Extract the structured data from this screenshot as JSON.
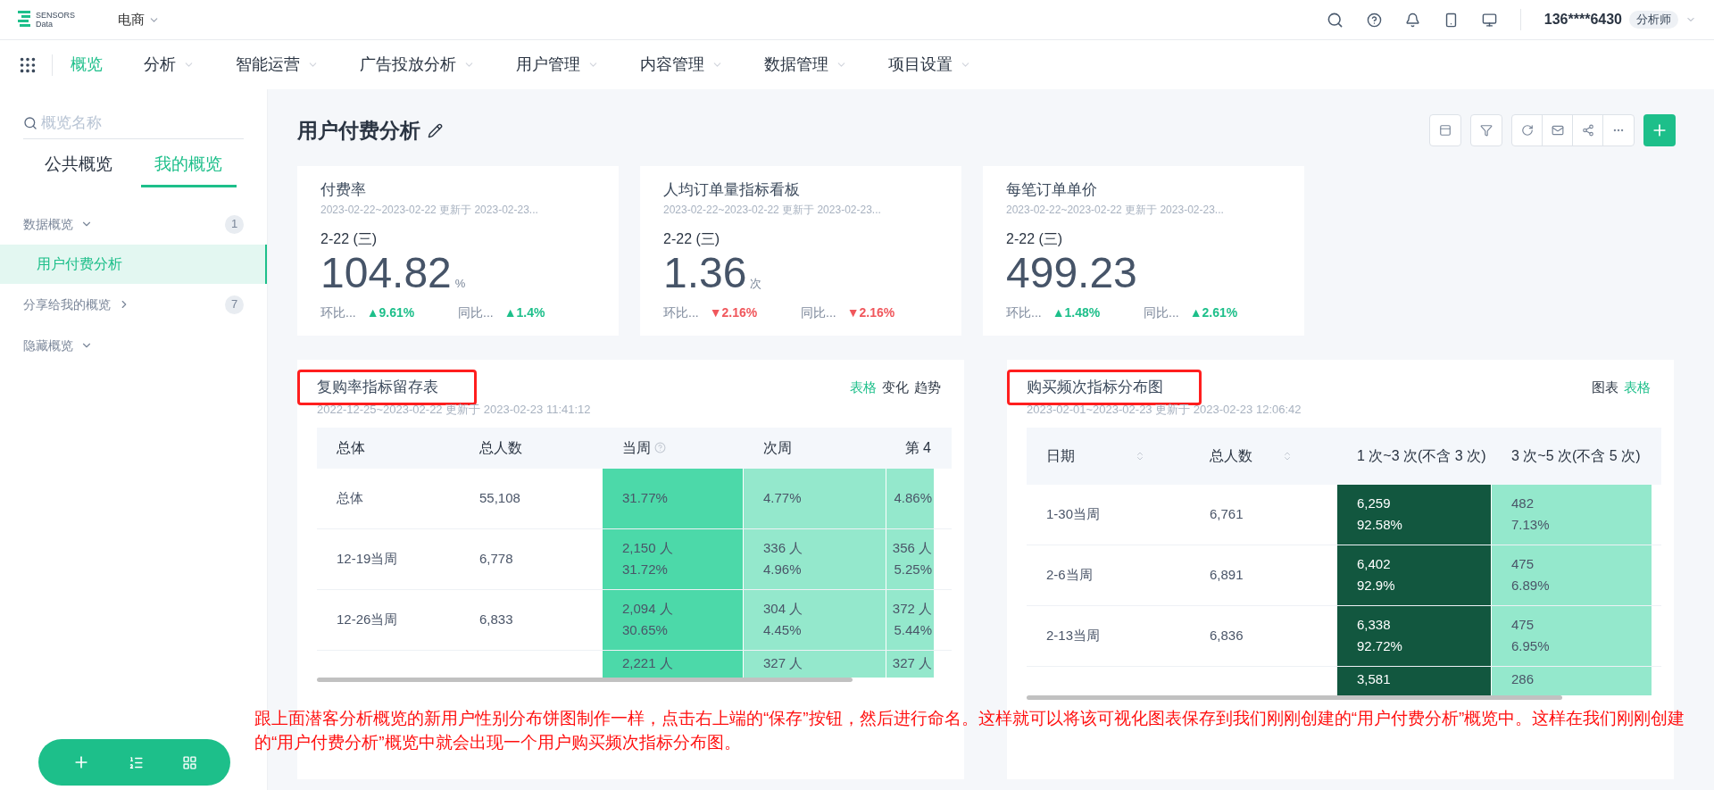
{
  "top_bar": {
    "logo_lines": [
      "SENSORS",
      "Data"
    ],
    "project": "电商",
    "user": "136****6430",
    "role": "分析师"
  },
  "nav": [
    {
      "label": "概览",
      "selected": true,
      "has_menu": false
    },
    {
      "label": "分析",
      "selected": false,
      "has_menu": true
    },
    {
      "label": "智能运营",
      "selected": false,
      "has_menu": true
    },
    {
      "label": "广告投放分析",
      "selected": false,
      "has_menu": true
    },
    {
      "label": "用户管理",
      "selected": false,
      "has_menu": true
    },
    {
      "label": "内容管理",
      "selected": false,
      "has_menu": true
    },
    {
      "label": "数据管理",
      "selected": false,
      "has_menu": true
    },
    {
      "label": "项目设置",
      "selected": false,
      "has_menu": true
    }
  ],
  "sidebar": {
    "search_placeholder": "概览名称",
    "tabs": [
      {
        "label": "公共概览",
        "selected": false
      },
      {
        "label": "我的概览",
        "selected": true
      }
    ],
    "groups": [
      {
        "label": "数据概览",
        "expanded": true,
        "count": "1",
        "children": [
          {
            "label": "用户付费分析",
            "selected": true
          }
        ]
      },
      {
        "label": "分享给我的概览",
        "expanded": false,
        "count": "7"
      },
      {
        "label": "隐藏概览",
        "expanded": true
      }
    ]
  },
  "page": {
    "title": "用户付费分析"
  },
  "cards": [
    {
      "title": "付费率",
      "subtitle": "2023-02-22~2023-02-22 更新于 2023-02-23...",
      "date": "2-22 (三)",
      "value": "104.82",
      "unit": "%",
      "comparisons": [
        {
          "label": "环比...",
          "value": "▲9.61%",
          "negative": false
        },
        {
          "label": "同比...",
          "value": "▲1.4%",
          "negative": false
        }
      ]
    },
    {
      "title": "人均订单量指标看板",
      "subtitle": "2023-02-22~2023-02-22 更新于 2023-02-23...",
      "date": "2-22 (三)",
      "value": "1.36",
      "unit": "次",
      "comparisons": [
        {
          "label": "环比...",
          "value": "▼2.16%",
          "negative": true
        },
        {
          "label": "同比...",
          "value": "▼2.16%",
          "negative": true
        }
      ]
    },
    {
      "title": "每笔订单单价",
      "subtitle": "2023-02-22~2023-02-22 更新于 2023-02-23...",
      "date": "2-22 (三)",
      "value": "499.23",
      "comparisons": [
        {
          "label": "环比...",
          "value": "▲1.48%",
          "negative": false
        },
        {
          "label": "同比...",
          "value": "▲2.61%",
          "negative": false
        }
      ]
    }
  ],
  "panels": [
    {
      "title": "复购率指标留存表",
      "highlighted": true,
      "subtitle": "2022-12-25~2023-02-22 更新于 2023-02-23 11:41:12",
      "view_tabs": [
        {
          "label": "表格",
          "selected": true
        },
        {
          "label": "变化",
          "selected": false
        },
        {
          "label": "趋势",
          "selected": false
        }
      ],
      "columns": [
        {
          "label": "总体"
        },
        {
          "label": "总人数"
        },
        {
          "label": "当周",
          "help": true
        },
        {
          "label": "次周"
        },
        {
          "label": "第 4",
          "right_aligned": true
        }
      ],
      "rows": [
        {
          "cells": [
            {
              "lines": [
                "总体"
              ]
            },
            {
              "lines": [
                "55,108"
              ]
            },
            {
              "lines": [
                "31.77%"
              ],
              "color": "#4cd9a9"
            },
            {
              "lines": [
                "4.77%"
              ],
              "color": "#94e8cc"
            },
            {
              "lines": [
                "4.86%"
              ],
              "color": "#94e8cc"
            }
          ]
        },
        {
          "cells": [
            {
              "lines": [
                "12-19当周"
              ]
            },
            {
              "lines": [
                "6,778"
              ]
            },
            {
              "lines": [
                "2,150 人",
                "31.72%"
              ],
              "color": "#4cd9a9"
            },
            {
              "lines": [
                "336 人",
                "4.96%"
              ],
              "color": "#94e8cc"
            },
            {
              "lines": [
                "356 人",
                "5.25%"
              ],
              "color": "#94e8cc"
            }
          ]
        },
        {
          "cells": [
            {
              "lines": [
                "12-26当周"
              ]
            },
            {
              "lines": [
                "6,833"
              ]
            },
            {
              "lines": [
                "2,094 人",
                "30.65%"
              ],
              "color": "#4cd9a9"
            },
            {
              "lines": [
                "304 人",
                "4.45%"
              ],
              "color": "#94e8cc"
            },
            {
              "lines": [
                "372 人",
                "5.44%"
              ],
              "color": "#94e8cc"
            }
          ]
        },
        {
          "cells": [
            {},
            {},
            {
              "lines": [
                "2,221 人"
              ],
              "color": "#4cd9a9"
            },
            {
              "lines": [
                "327 人"
              ],
              "color": "#94e8cc"
            },
            {
              "lines": [
                "327 人"
              ],
              "color": "#94e8cc"
            }
          ]
        }
      ]
    },
    {
      "title": "购买频次指标分布图",
      "highlighted": true,
      "subtitle": "2023-02-01~2023-02-23 更新于 2023-02-23 12:06:42",
      "view_tabs": [
        {
          "label": "图表",
          "selected": false
        },
        {
          "label": "表格",
          "selected": true
        }
      ],
      "columns": [
        {
          "label": "日期",
          "sortable": true
        },
        {
          "label": "总人数",
          "sortable": true
        },
        {
          "label": "1 次~3 次(不含 3 次)"
        },
        {
          "label": "3 次~5 次(不含 5 次)"
        }
      ],
      "rows": [
        {
          "cells": [
            {
              "lines": [
                "1-30当周"
              ]
            },
            {
              "lines": [
                "6,761"
              ]
            },
            {
              "lines": [
                "6,259",
                "92.58%"
              ],
              "color": "#12573f"
            },
            {
              "lines": [
                "482",
                "7.13%"
              ],
              "color": "#94e8cc"
            }
          ]
        },
        {
          "cells": [
            {
              "lines": [
                "2-6当周"
              ]
            },
            {
              "lines": [
                "6,891"
              ]
            },
            {
              "lines": [
                "6,402",
                "92.9%"
              ],
              "color": "#12573f"
            },
            {
              "lines": [
                "475",
                "6.89%"
              ],
              "color": "#94e8cc"
            }
          ]
        },
        {
          "cells": [
            {
              "lines": [
                "2-13当周"
              ]
            },
            {
              "lines": [
                "6,836"
              ]
            },
            {
              "lines": [
                "6,338",
                "92.72%"
              ],
              "color": "#12573f"
            },
            {
              "lines": [
                "475",
                "6.95%"
              ],
              "color": "#94e8cc"
            }
          ]
        },
        {
          "cells": [
            {},
            {},
            {
              "lines": [
                "3,581"
              ],
              "color": "#12573f"
            },
            {
              "lines": [
                "286"
              ],
              "color": "#94e8cc"
            }
          ]
        }
      ]
    }
  ],
  "annotation": "跟上面潜客分析概览的新用户性别分布饼图制作一样，点击右上端的“保存”按钮，然后进行命名。这样就可以将该可视化图表保存到我们刚刚创建的“用户付费分析”概览中。这样在我们刚刚创建的“用户付费分析”概览中就会出现一个用户购买频次指标分布图。"
}
